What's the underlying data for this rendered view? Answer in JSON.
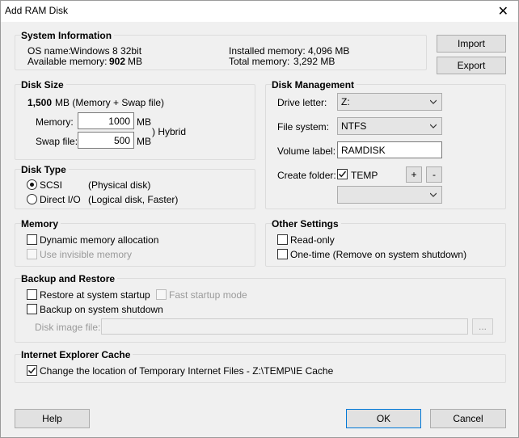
{
  "window": {
    "title": "Add RAM Disk"
  },
  "system_info": {
    "title": "System Information",
    "os_label": "OS name:",
    "os_value": "Windows 8 32bit",
    "avail_label": "Available memory:",
    "avail_value": "902",
    "avail_unit": "MB",
    "installed_label": "Installed memory:",
    "installed_value": "4,096 MB",
    "total_label": "Total memory:",
    "total_value": "3,292 MB"
  },
  "buttons": {
    "import": "Import",
    "export": "Export",
    "help": "Help",
    "ok": "OK",
    "cancel": "Cancel"
  },
  "disk_size": {
    "title": "Disk Size",
    "total_value": "1,500",
    "total_suffix": "MB (Memory + Swap file)",
    "memory_label": "Memory:",
    "memory_value": "1000",
    "memory_unit": "MB",
    "swap_label": "Swap file:",
    "swap_value": "500",
    "swap_unit": "MB",
    "hybrid": ") Hybrid"
  },
  "disk_type": {
    "title": "Disk Type",
    "scsi_label": "SCSI",
    "scsi_desc": "(Physical disk)",
    "direct_label": "Direct I/O",
    "direct_desc": "(Logical disk, Faster)"
  },
  "memory": {
    "title": "Memory",
    "dynamic_label": "Dynamic memory allocation",
    "invisible_label": "Use invisible memory"
  },
  "disk_management": {
    "title": "Disk Management",
    "drive_label": "Drive letter:",
    "drive_value": "Z:",
    "fs_label": "File system:",
    "fs_value": "NTFS",
    "volume_label": "Volume label:",
    "volume_value": "RAMDISK",
    "folder_label": "Create folder:",
    "folder_value": "TEMP",
    "plus": "+",
    "minus": "-",
    "folder_combo_value": ""
  },
  "other_settings": {
    "title": "Other Settings",
    "readonly_label": "Read-only",
    "onetime_label": "One-time (Remove on system shutdown)"
  },
  "backup": {
    "title": "Backup and Restore",
    "restore_label": "Restore at system startup",
    "fast_label": "Fast startup mode",
    "backup_label": "Backup on system shutdown",
    "image_label": "Disk image file:",
    "image_value": "",
    "browse": "..."
  },
  "ie_cache": {
    "title": "Internet Explorer Cache",
    "change_label": "Change the location of Temporary Internet Files - Z:\\TEMP\\IE Cache"
  }
}
